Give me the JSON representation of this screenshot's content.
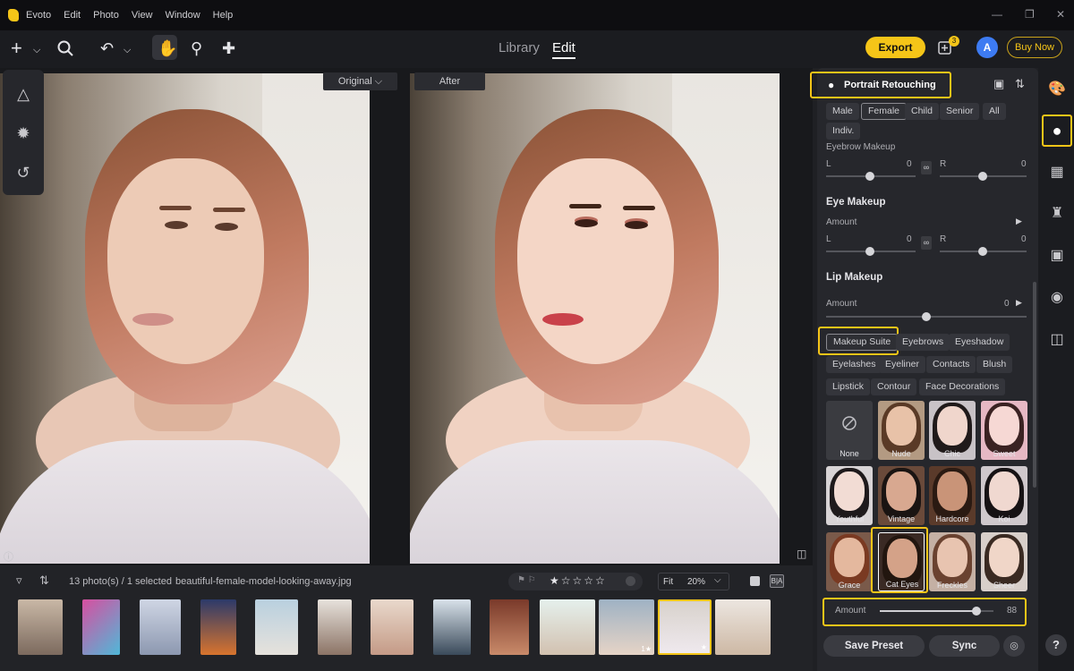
{
  "app": {
    "title": "Evoto"
  },
  "menu": [
    "Edit",
    "Photo",
    "View",
    "Window",
    "Help"
  ],
  "toolbar": {
    "modes": {
      "library": "Library",
      "edit": "Edit",
      "active": "Edit"
    },
    "export_label": "Export",
    "notification_count": "3",
    "avatar_letter": "A",
    "buy_now_label": "Buy Now"
  },
  "canvas": {
    "original_label": "Original",
    "after_label": "After"
  },
  "filmstrip": {
    "photo_count_text": "13 photo(s) / 1 selected",
    "filename": "beautiful-female-model-looking-away.jpg",
    "fit_label": "Fit",
    "zoom_value": "20%",
    "before_after_label": "B|A",
    "thumb_badges": [
      "1★",
      "★"
    ]
  },
  "panel": {
    "title": "Portrait Retouching",
    "gender_chips": [
      "Male",
      "Female",
      "Child",
      "Senior",
      "All",
      "Indiv."
    ],
    "gender_selected": "Female",
    "eyebrow": {
      "title": "Eyebrow Makeup",
      "left_label": "L",
      "left_value": "0",
      "right_label": "R",
      "right_value": "0"
    },
    "eye_makeup": {
      "title": "Eye Makeup",
      "amount_label": "Amount",
      "left_label": "L",
      "left_value": "0",
      "right_label": "R",
      "right_value": "0"
    },
    "lip_makeup": {
      "title": "Lip Makeup",
      "amount_label": "Amount",
      "amount_value": "0"
    },
    "makeup_categories": [
      "Makeup Suite",
      "Eyebrows",
      "Eyeshadow",
      "Eyelashes",
      "Eyeliner",
      "Contacts",
      "Blush",
      "Lipstick",
      "Contour",
      "Face Decorations"
    ],
    "makeup_selected": "Makeup Suite",
    "presets": [
      "None",
      "Nude",
      "Chic",
      "Sweet",
      "Youthful",
      "Vintage",
      "Hardcore",
      "Koi",
      "Grace",
      "Cat Eyes",
      "Freckles",
      "Sheer"
    ],
    "preset_selected": "Cat Eyes",
    "amount": {
      "label": "Amount",
      "value": "88",
      "level": 88
    },
    "save_preset_label": "Save Preset",
    "sync_label": "Sync"
  },
  "colors": {
    "accent": "#f5c518",
    "panel": "#26272c",
    "background": "#1b1c20"
  },
  "icons": [
    "add-icon",
    "search-icon",
    "undo-icon",
    "hand-icon",
    "brush-icon",
    "bandage-icon",
    "palette-icon",
    "face-icon",
    "grid-icon",
    "shirt-icon",
    "crop-icon",
    "camera-icon",
    "folder-icon",
    "help-icon"
  ]
}
